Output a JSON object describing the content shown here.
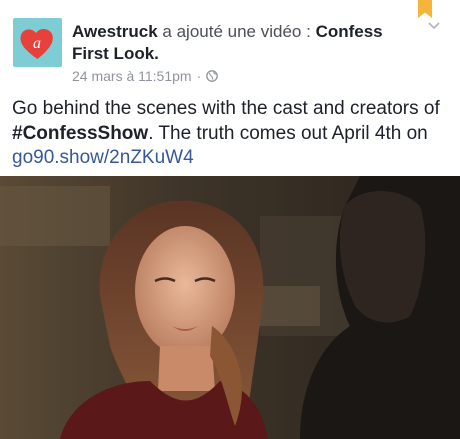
{
  "post": {
    "author": "Awestruck",
    "verb": "a ajouté une vidéo :",
    "video_title": "Confess First Look.",
    "timestamp": "24 mars à 11:51pm",
    "separator": "·",
    "text_intro": "Go behind the scenes with the cast and creators of",
    "hashtag": "#ConfessShow",
    "text_after": ". The truth comes out April 4th on",
    "link": "go90.show/2nZKuW4"
  },
  "icons": {
    "avatar": "heart-logo-icon",
    "privacy": "globe-icon",
    "menu": "chevron-down-icon",
    "saved": "bookmark-icon"
  },
  "colors": {
    "avatar_bg": "#7ecdd4",
    "heart": "#e8403a",
    "link": "#365899",
    "meta": "#90949c",
    "bookmark": "#f5b53a"
  }
}
